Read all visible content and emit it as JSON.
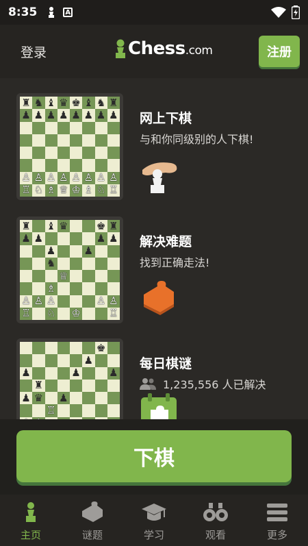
{
  "status": {
    "time": "8:35",
    "a_icon_letter": "A"
  },
  "header": {
    "login": "登录",
    "logo_main": "Chess",
    "logo_suffix": ".com",
    "register": "注册"
  },
  "cards": [
    {
      "title": "网上下棋",
      "subtitle": "与和你同级别的人下棋!"
    },
    {
      "title": "解决难题",
      "subtitle": "找到正确走法!"
    },
    {
      "title": "每日棋谜",
      "subtitle": "1,235,556 人已解决"
    }
  ],
  "boards": [
    [
      [
        "♜",
        "♞",
        "♝",
        "♛",
        "♚",
        "♝",
        "♞",
        "♜"
      ],
      [
        "♟",
        "♟",
        "♟",
        "♟",
        "♟",
        "♟",
        "♟",
        "♟"
      ],
      [
        "",
        "",
        "",
        "",
        "",
        "",
        "",
        ""
      ],
      [
        "",
        "",
        "",
        "",
        "",
        "",
        "",
        ""
      ],
      [
        "",
        "",
        "",
        "",
        "",
        "",
        "",
        ""
      ],
      [
        "",
        "",
        "",
        "",
        "",
        "",
        "",
        ""
      ],
      [
        "♙",
        "♙",
        "♙",
        "♙",
        "♙",
        "♙",
        "♙",
        "♙"
      ],
      [
        "♖",
        "♘",
        "♗",
        "♕",
        "♔",
        "♗",
        "♘",
        "♖"
      ]
    ],
    [
      [
        "♜",
        "",
        "♝",
        "♛",
        "",
        "",
        "♚",
        "♜"
      ],
      [
        "♟",
        "♟",
        "",
        "",
        "",
        "",
        "♟",
        "♟"
      ],
      [
        "",
        "",
        "♟",
        "",
        "",
        "♟",
        "",
        ""
      ],
      [
        "",
        "",
        "♞",
        "",
        "",
        "",
        "",
        ""
      ],
      [
        "",
        "",
        "",
        "♕",
        "",
        "",
        "",
        ""
      ],
      [
        "",
        "",
        "♗",
        "",
        "",
        "",
        "",
        ""
      ],
      [
        "♙",
        "♙",
        "♙",
        "",
        "",
        "",
        "♙",
        "♙"
      ],
      [
        "♖",
        "",
        "♘",
        "",
        "♔",
        "",
        "",
        "♖"
      ]
    ],
    [
      [
        "",
        "",
        "",
        "",
        "",
        "",
        "♚",
        ""
      ],
      [
        "",
        "",
        "",
        "",
        "",
        "♟",
        "",
        ""
      ],
      [
        "♟",
        "",
        "",
        "",
        "♟",
        "",
        "",
        "♟"
      ],
      [
        "",
        "♜",
        "",
        "",
        "",
        "",
        "",
        ""
      ],
      [
        "♟",
        "♛",
        "",
        "♟",
        "",
        "",
        "",
        ""
      ],
      [
        "",
        "",
        "♖",
        "",
        "",
        "",
        "",
        ""
      ],
      [
        "♙",
        "♙",
        "",
        "",
        "",
        "",
        "",
        ""
      ],
      [
        "",
        "",
        "",
        "",
        "",
        "",
        "",
        ""
      ]
    ]
  ],
  "play_button": "下棋",
  "nav": [
    {
      "label": "主页",
      "icon": "pawn-icon",
      "active": true
    },
    {
      "label": "谜题",
      "icon": "puzzle-icon",
      "active": false
    },
    {
      "label": "学习",
      "icon": "graduation-cap-icon",
      "active": false
    },
    {
      "label": "观看",
      "icon": "binoculars-icon",
      "active": false
    },
    {
      "label": "更多",
      "icon": "menu-icon",
      "active": false
    }
  ],
  "colors": {
    "accent": "#81b64c",
    "board_light": "#eeeed2",
    "board_dark": "#769656",
    "background": "#2b2926"
  }
}
